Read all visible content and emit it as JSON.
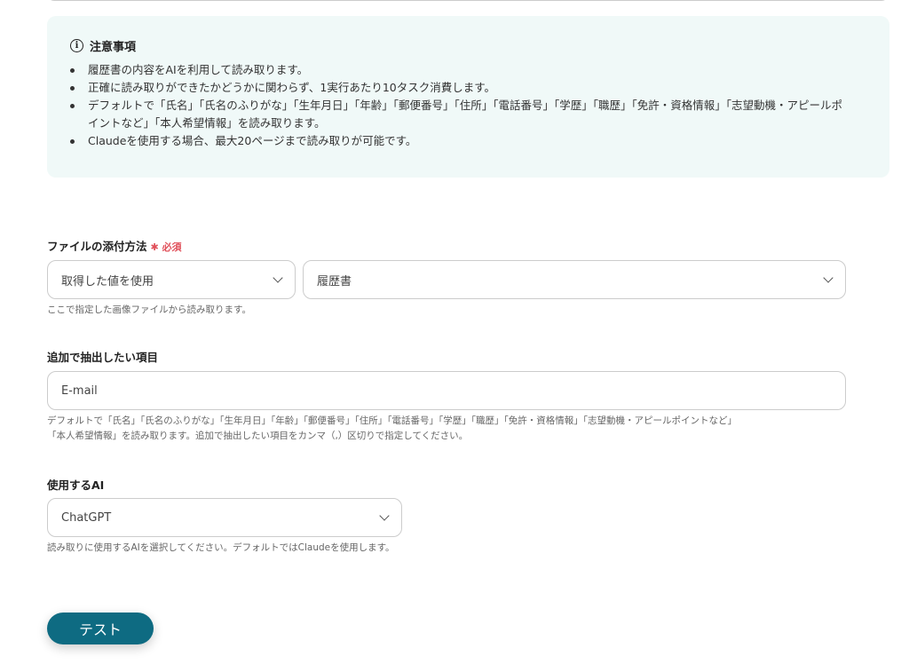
{
  "notice": {
    "title": "注意事項",
    "items": [
      "履歴書の内容をAIを利用して読み取ります。",
      "正確に読み取りができたかどうかに関わらず、1実行あたり10タスク消費します。",
      "デフォルトで「氏名」「氏名のふりがな」「生年月日」「年齢」「郵便番号」「住所」「電話番号」「学歴」「職歴」「免許・資格情報」「志望動機・アピールポイントなど」「本人希望情報」を読み取ります。",
      "Claudeを使用する場合、最大20ページまで読み取りが可能です。"
    ]
  },
  "attach": {
    "label": "ファイルの添付方法",
    "required": "必須",
    "method": "取得した値を使用",
    "value": "履歴書",
    "help": "ここで指定した画像ファイルから読み取ります。"
  },
  "extra": {
    "label": "追加で抽出したい項目",
    "value": "E-mail",
    "help1": "デフォルトで「氏名」「氏名のふりがな」「生年月日」「年齢」「郵便番号」「住所」「電話番号」「学歴」「職歴」「免許・資格情報」「志望動機・アピールポイントなど」",
    "help2": "「本人希望情報」を読み取ります。追加で抽出したい項目をカンマ（,）区切りで指定してください。"
  },
  "ai": {
    "label": "使用するAI",
    "value": "ChatGPT",
    "help": "読み取りに使用するAIを選択してください。デフォルトではClaudeを使用します。"
  },
  "test_button": "テスト"
}
